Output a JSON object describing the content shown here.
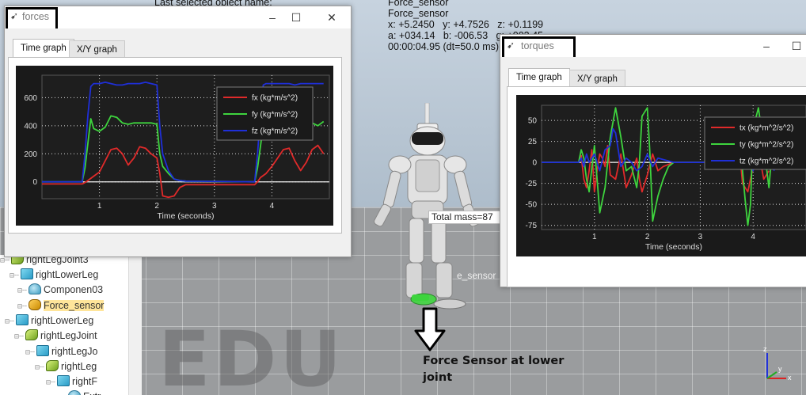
{
  "scene": {
    "last_selected": "Last selected object name:",
    "object_name_1": "Force_sensor",
    "object_name_2": "Force_sensor",
    "position_line": "x: +5.2450   y: +4.7526   z: +0.1199",
    "orientation_line": "a: +034.14   b: -006.53   g: +002.45",
    "time_line": "00:00:04.95 (dt=50.0 ms)",
    "mass_label": "Total mass=87",
    "sensor_tag": "e_sensor",
    "watermark": "EDU",
    "annotation": "Force Sensor at lower joint",
    "axis_labels": {
      "z": "z",
      "y": "y",
      "x": "x"
    }
  },
  "hierarchy": {
    "items": [
      {
        "label": "rightLegJoint3",
        "icon": "joint-icon",
        "selected": false
      },
      {
        "label": "rightLowerLeg",
        "icon": "shape-icon",
        "selected": false
      },
      {
        "label": "Componen03",
        "icon": "dummy-icon",
        "selected": false
      },
      {
        "label": "Force_sensor",
        "icon": "sensor-icon",
        "selected": true
      },
      {
        "label": "rightLowerLeg",
        "icon": "shape-icon",
        "selected": false
      },
      {
        "label": "rightLegJoint",
        "icon": "joint-icon",
        "selected": false
      },
      {
        "label": "rightLegJo",
        "icon": "shape-icon",
        "selected": false
      },
      {
        "label": "rightLeg",
        "icon": "joint-icon",
        "selected": false
      },
      {
        "label": "rightF",
        "icon": "shape-icon",
        "selected": false
      },
      {
        "label": "Extr",
        "icon": "dummy-icon",
        "selected": false
      }
    ]
  },
  "forces_window": {
    "title": "forces",
    "tabs": [
      "Time graph",
      "X/Y graph"
    ],
    "active_tab": "Time graph",
    "buttons": {
      "minimize": "–",
      "maximize": "☐",
      "close": "✕"
    }
  },
  "torques_window": {
    "title": "torques",
    "tabs": [
      "Time graph",
      "X/Y graph"
    ],
    "active_tab": "Time graph",
    "buttons": {
      "minimize": "–",
      "maximize": "☐"
    }
  },
  "chart_data": [
    {
      "type": "line",
      "xlabel": "Time (seconds)",
      "ylabel": "",
      "xlim": [
        0,
        5.0
      ],
      "ylim": [
        -120,
        760
      ],
      "xticks": [
        1,
        2,
        3,
        4
      ],
      "yticks": [
        0,
        200,
        400,
        600
      ],
      "legend_position": "top-right",
      "grid": true,
      "series": [
        {
          "name": "fx (kg*m/s^2)",
          "color": "#e02a2a",
          "x": [
            0,
            0.7,
            0.75,
            0.8,
            0.9,
            1.0,
            1.1,
            1.2,
            1.3,
            1.4,
            1.5,
            1.6,
            1.7,
            1.8,
            1.9,
            2.0,
            2.05,
            2.1,
            2.2,
            2.3,
            2.4,
            2.5,
            3.7,
            3.75,
            3.8,
            3.9,
            4.0,
            4.1,
            4.2,
            4.3,
            4.4,
            4.5,
            4.6,
            4.7,
            4.8,
            4.9
          ],
          "y": [
            -15,
            -15,
            -5,
            10,
            40,
            70,
            150,
            230,
            240,
            200,
            120,
            170,
            250,
            240,
            200,
            170,
            60,
            -100,
            -110,
            -100,
            -40,
            -20,
            -20,
            0,
            30,
            60,
            110,
            170,
            230,
            240,
            150,
            80,
            140,
            230,
            260,
            200
          ]
        },
        {
          "name": "fy (kg*m/s^2)",
          "color": "#3ed43e",
          "x": [
            0,
            0.7,
            0.75,
            0.8,
            0.85,
            0.9,
            1.0,
            1.1,
            1.2,
            1.3,
            1.4,
            1.5,
            1.6,
            1.7,
            1.8,
            1.9,
            2.0,
            2.05,
            2.1,
            2.2,
            2.3,
            2.4,
            2.5,
            3.7,
            3.75,
            3.8,
            3.85,
            3.9,
            4.0,
            4.1,
            4.2,
            4.3,
            4.4,
            4.5,
            4.6,
            4.7,
            4.8,
            4.9
          ],
          "y": [
            0,
            0,
            100,
            280,
            450,
            380,
            360,
            390,
            470,
            460,
            420,
            410,
            420,
            420,
            420,
            420,
            410,
            200,
            110,
            60,
            20,
            10,
            5,
            0,
            100,
            250,
            400,
            340,
            310,
            380,
            430,
            440,
            410,
            330,
            390,
            420,
            400,
            430
          ]
        },
        {
          "name": "fz (kg*m/s^2)",
          "color": "#1f2fd8",
          "x": [
            0,
            0.7,
            0.75,
            0.8,
            0.85,
            0.9,
            1.0,
            1.1,
            1.2,
            1.3,
            1.4,
            1.5,
            1.6,
            1.7,
            1.8,
            1.9,
            2.0,
            2.05,
            2.1,
            2.2,
            2.3,
            2.4,
            2.5,
            3.7,
            3.75,
            3.8,
            3.85,
            3.9,
            4.0,
            4.1,
            4.2,
            4.3,
            4.4,
            4.5,
            4.6,
            4.7,
            4.8,
            4.9
          ],
          "y": [
            0,
            0,
            200,
            480,
            680,
            700,
            700,
            710,
            700,
            690,
            690,
            700,
            700,
            700,
            710,
            700,
            690,
            400,
            200,
            80,
            20,
            10,
            5,
            0,
            200,
            480,
            690,
            700,
            700,
            700,
            700,
            700,
            690,
            700,
            700,
            700,
            700,
            700
          ]
        }
      ]
    },
    {
      "type": "line",
      "xlabel": "Time (seconds)",
      "ylabel": "",
      "xlim": [
        0,
        5.0
      ],
      "ylim": [
        -80,
        68
      ],
      "xticks": [
        1,
        2,
        3,
        4
      ],
      "yticks": [
        -75,
        -50,
        -25,
        0,
        25,
        50
      ],
      "legend_position": "top-right",
      "grid": true,
      "series": [
        {
          "name": "tx (kg*m^2/s^2)",
          "color": "#e02a2a",
          "x": [
            0,
            0.7,
            0.75,
            0.8,
            0.85,
            0.9,
            0.95,
            1.0,
            1.05,
            1.1,
            1.15,
            1.2,
            1.25,
            1.3,
            1.4,
            1.5,
            1.6,
            1.7,
            1.8,
            1.85,
            1.9,
            2.0,
            2.1,
            2.2,
            2.3,
            2.5,
            3.7,
            3.75,
            3.8,
            3.9,
            4.0,
            4.1,
            4.2,
            4.3
          ],
          "y": [
            0,
            0,
            8,
            -20,
            -30,
            -10,
            15,
            -35,
            -10,
            10,
            5,
            -5,
            20,
            -15,
            -20,
            10,
            -30,
            -15,
            5,
            -20,
            -35,
            -15,
            10,
            -10,
            -5,
            0,
            0,
            10,
            -25,
            -35,
            -5,
            15,
            -20,
            -10
          ]
        },
        {
          "name": "ty (kg*m^2/s^2)",
          "color": "#3ed43e",
          "x": [
            0,
            0.7,
            0.75,
            0.8,
            0.85,
            0.9,
            1.0,
            1.1,
            1.2,
            1.3,
            1.4,
            1.5,
            1.6,
            1.7,
            1.8,
            1.85,
            1.9,
            2.0,
            2.05,
            2.1,
            2.2,
            2.3,
            2.4,
            2.5,
            3.7,
            3.75,
            3.8,
            3.85,
            3.9,
            3.95,
            4.0,
            4.1,
            4.2,
            4.3,
            4.4,
            4.5,
            4.6
          ],
          "y": [
            0,
            0,
            15,
            5,
            -20,
            -35,
            20,
            -60,
            -30,
            30,
            65,
            30,
            -10,
            -5,
            -30,
            0,
            55,
            65,
            10,
            -70,
            -40,
            -20,
            -5,
            0,
            0,
            30,
            -10,
            -45,
            -75,
            -50,
            40,
            65,
            20,
            -30,
            45,
            50,
            10
          ]
        },
        {
          "name": "tz (kg*m^2/s^2)",
          "color": "#1f2fd8",
          "x": [
            0,
            0.7,
            0.75,
            0.8,
            0.85,
            0.9,
            1.0,
            1.1,
            1.2,
            1.3,
            1.35,
            1.4,
            1.5,
            1.6,
            1.7,
            1.8,
            1.9,
            2.0,
            2.1,
            2.2,
            2.5,
            3.7,
            3.8,
            3.9,
            4.0,
            4.1,
            4.2,
            4.3,
            4.4
          ],
          "y": [
            0,
            0,
            5,
            -5,
            10,
            0,
            10,
            -10,
            15,
            20,
            40,
            35,
            -5,
            5,
            0,
            -10,
            -5,
            10,
            -5,
            5,
            0,
            0,
            15,
            20,
            -10,
            15,
            10,
            5,
            -10
          ]
        }
      ]
    }
  ]
}
